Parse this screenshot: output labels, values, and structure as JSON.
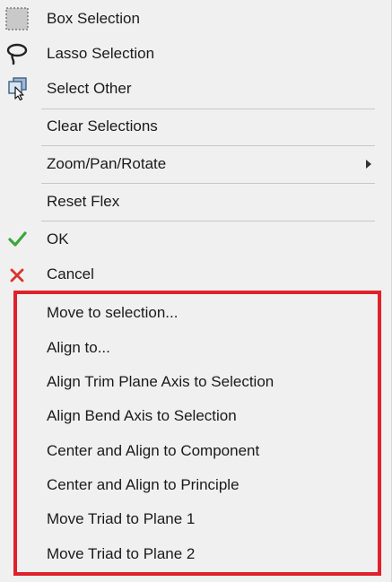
{
  "menu": {
    "items": [
      {
        "label": "Box Selection",
        "icon": "box-selection-icon"
      },
      {
        "label": "Lasso Selection",
        "icon": "lasso-icon"
      },
      {
        "label": "Select Other",
        "icon": "select-other-icon"
      },
      {
        "label": "Clear Selections"
      },
      {
        "label": "Zoom/Pan/Rotate",
        "has_submenu": true
      },
      {
        "label": "Reset Flex"
      },
      {
        "label": "OK",
        "icon": "checkmark-icon"
      },
      {
        "label": "Cancel",
        "icon": "cancel-x-icon"
      },
      {
        "label": "Move to selection..."
      },
      {
        "label": "Align to..."
      },
      {
        "label": "Align Trim Plane Axis to Selection"
      },
      {
        "label": "Align Bend Axis to Selection"
      },
      {
        "label": "Center and Align to Component"
      },
      {
        "label": "Center and Align to Principle"
      },
      {
        "label": "Move Triad to Plane 1"
      },
      {
        "label": "Move Triad to Plane 2"
      }
    ]
  },
  "colors": {
    "menu_background": "#f0f0f0",
    "highlight_border": "#e0202a",
    "ok_green": "#3aa63a",
    "cancel_red": "#d9342b"
  }
}
